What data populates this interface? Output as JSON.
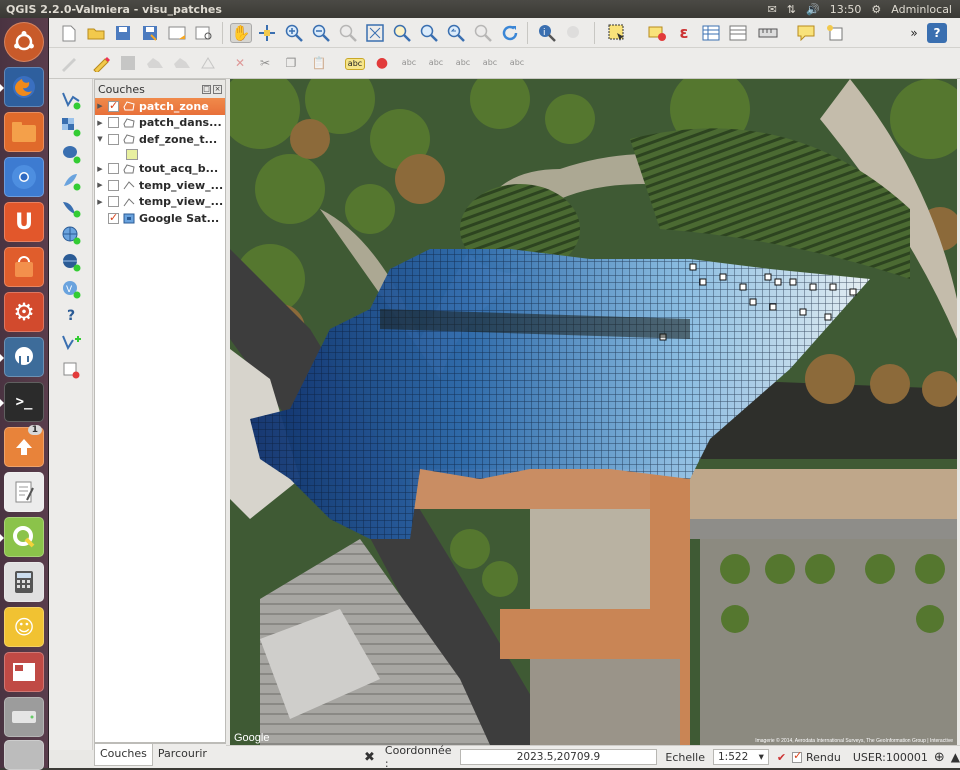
{
  "window": {
    "title": "QGIS 2.2.0-Valmiera - visu_patches"
  },
  "topbar": {
    "time": "13:50",
    "user": "Adminlocal"
  },
  "launcher": {
    "badge": "1"
  },
  "layers_panel": {
    "title": "Couches",
    "layers": [
      {
        "name": "patch_zone",
        "checked": true,
        "selected": true
      },
      {
        "name": "patch_dans...",
        "checked": false
      },
      {
        "name": "def_zone_t...",
        "checked": false,
        "expanded": true
      },
      {
        "name": "tout_acq_b...",
        "checked": false
      },
      {
        "name": "temp_view_...",
        "checked": false
      },
      {
        "name": "temp_view_...",
        "checked": false
      },
      {
        "name": "Google Sat...",
        "checked": true
      }
    ],
    "tabs": [
      "Couches",
      "Parcourir"
    ]
  },
  "status": {
    "coord_label": "Coordonnée :",
    "coord_value": "2023.5,20709.9",
    "scale_label": "Echelle",
    "scale_value": "1:522",
    "render_label": "Rendu",
    "crs": "USER:100001"
  },
  "map": {
    "google_logo": "Google",
    "attribution": "Imagerie © 2014, Aerodata International Surveys, The GeoInformation Group | Interactive"
  },
  "colors": {
    "selection": "#e8703a",
    "patch_dark": "#0d2f6b",
    "patch_light": "#b7dbf4",
    "accent_red": "#d9441d"
  }
}
